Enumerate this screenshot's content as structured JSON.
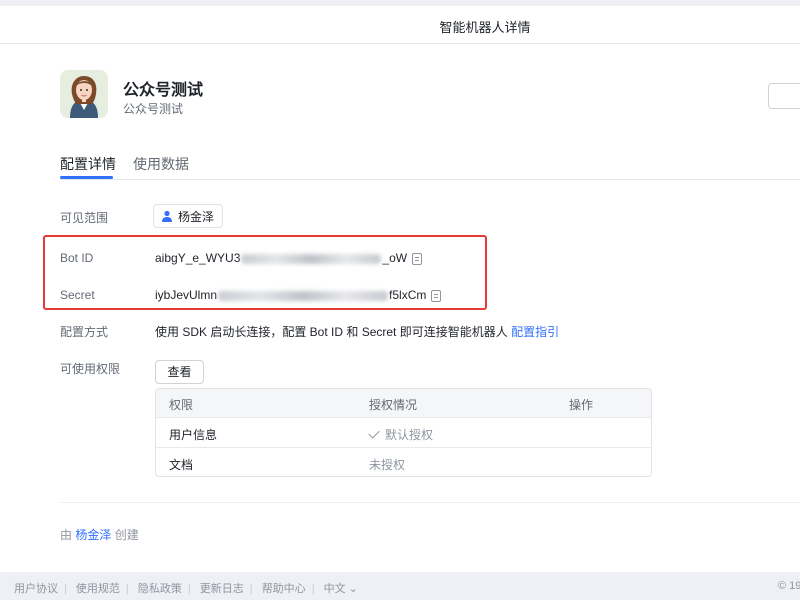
{
  "page": {
    "title": "智能机器人详情"
  },
  "bot": {
    "name": "公众号测试",
    "subtitle": "公众号测试"
  },
  "tabs": [
    {
      "label": "配置详情",
      "active": true
    },
    {
      "label": "使用数据",
      "active": false
    }
  ],
  "fields": {
    "visibility": {
      "label": "可见范围",
      "user": "杨金泽"
    },
    "bot_id": {
      "label": "Bot ID",
      "prefix": "aibgY_e_WYU3",
      "suffix": "_oW"
    },
    "secret": {
      "label": "Secret",
      "prefix": "iybJevUlmn",
      "suffix": "f5lxCm"
    },
    "config_method": {
      "label": "配置方式",
      "text": "使用 SDK 启动长连接，配置 Bot ID 和 Secret 即可连接智能机器人",
      "link": "配置指引"
    },
    "permissions": {
      "label": "可使用权限",
      "view_button": "查看",
      "columns": [
        "权限",
        "授权情况",
        "操作"
      ],
      "rows": [
        {
          "name": "用户信息",
          "status": "默认授权"
        },
        {
          "name": "文档",
          "status": "未授权"
        }
      ]
    }
  },
  "creator": {
    "prefix": "由",
    "name": "杨金泽",
    "suffix": "创建"
  },
  "footer": {
    "links": [
      "用户协议",
      "使用规范",
      "隐私政策",
      "更新日志",
      "帮助中心"
    ],
    "language": "中文",
    "right_text": "© 19"
  },
  "colors": {
    "accent": "#3370ff",
    "highlight": "#e53935",
    "text": "#1f2329",
    "muted": "#646a73"
  }
}
